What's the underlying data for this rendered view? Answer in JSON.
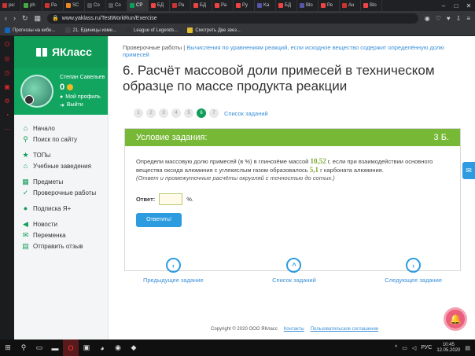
{
  "browser": {
    "tabs": [
      {
        "label": "ре:",
        "color": "#c33"
      },
      {
        "label": "ph",
        "color": "#4a4"
      },
      {
        "label": "Ра",
        "color": "#c33"
      },
      {
        "label": "SC",
        "color": "#e82"
      },
      {
        "label": "Co",
        "color": "#555"
      },
      {
        "label": "Co",
        "color": "#555"
      },
      {
        "label": "СР",
        "color": "#0f9d58",
        "active": true
      },
      {
        "label": "БД",
        "color": "#e44"
      },
      {
        "label": "Ра",
        "color": "#c33"
      },
      {
        "label": "БД",
        "color": "#e44"
      },
      {
        "label": "Ра",
        "color": "#e44"
      },
      {
        "label": "Ру",
        "color": "#e44"
      },
      {
        "label": "Ka",
        "color": "#55a"
      },
      {
        "label": "БД",
        "color": "#e44"
      },
      {
        "label": "Blo",
        "color": "#55a"
      },
      {
        "label": "Ре",
        "color": "#e44"
      },
      {
        "label": "Ан",
        "color": "#c33"
      },
      {
        "label": "Blo",
        "color": "#e44"
      }
    ],
    "url": "www.yaklass.ru/TestWorkRun/Exercise",
    "bookmarks": [
      {
        "label": "Прогнозы на кибе...",
        "color": "#1565c0"
      },
      {
        "label": "21. Единицы изме...",
        "color": "#444"
      },
      {
        "label": "League of Legends...",
        "color": "#333"
      },
      {
        "label": "Смотреть Две звез...",
        "color": "#e0c030"
      }
    ]
  },
  "site": {
    "logo": "ЯКласс",
    "profile": {
      "name": "Степан Савельев",
      "points": "0",
      "my_profile": "Мой профиль",
      "logout": "Выйти"
    },
    "menu": [
      {
        "icon": "home-icon",
        "glyph": "⌂",
        "label": "Начало"
      },
      {
        "icon": "search-icon",
        "glyph": "⚲",
        "label": "Поиск по сайту"
      },
      {
        "gap": true
      },
      {
        "icon": "trophy-icon",
        "glyph": "★",
        "label": "ТОПы"
      },
      {
        "icon": "school-icon",
        "glyph": "⌂",
        "label": "Учебные заведения"
      },
      {
        "gap": true
      },
      {
        "icon": "subjects-icon",
        "glyph": "▦",
        "label": "Предметы"
      },
      {
        "icon": "check-icon",
        "glyph": "✓",
        "label": "Проверочные работы"
      },
      {
        "gap": true
      },
      {
        "icon": "subscription-icon",
        "glyph": "●",
        "label": "Подписка Я+"
      },
      {
        "gap": true
      },
      {
        "icon": "news-icon",
        "glyph": "◀",
        "label": "Новости"
      },
      {
        "icon": "message-icon",
        "glyph": "✉",
        "label": "Переменка"
      },
      {
        "icon": "feedback-icon",
        "glyph": "▤",
        "label": "Отправить отзыв"
      }
    ]
  },
  "main": {
    "breadcrumb_root": "Проверочные работы",
    "breadcrumb_sep": "|",
    "breadcrumb_current": "Вычисления по уравнениям реакций, если исходное вещество содержит определённую долю примесей",
    "title": "6. Расчёт массовой доли примесей в техническом образце по массе продукта реакции",
    "pages": [
      "1",
      "2",
      "3",
      "4",
      "5",
      "6",
      "7"
    ],
    "active_page": "6",
    "task_list_label": "Список заданий",
    "task": {
      "header": "Условие задания:",
      "points": "3 Б.",
      "text_1": "Определи массовую долю примесей (в %) в глинозёме массой",
      "mass_1": "10,52",
      "text_2": "г, если при взаимодействии основного вещества оксида алюминия с углекислым газом образовалось",
      "mass_2": "5,1",
      "text_3": "г карбоната алюминия.",
      "hint": "(Ответ и промежуточные расчёты округляй с точностью до сотых.)",
      "answer_label": "Ответ:",
      "answer_value": "",
      "answer_unit": "%.",
      "submit_label": "Ответить!"
    },
    "nav": {
      "prev": "Предыдущее задание",
      "list": "Список заданий",
      "next": "Следующее задание"
    },
    "footer": {
      "copyright": "Copyright © 2020 ООО ЯКласс",
      "contacts": "Контакты",
      "agreement": "Пользовательское соглашение"
    }
  },
  "taskbar": {
    "lang": "РУС",
    "time": "10:45",
    "date": "12.05.2020"
  }
}
